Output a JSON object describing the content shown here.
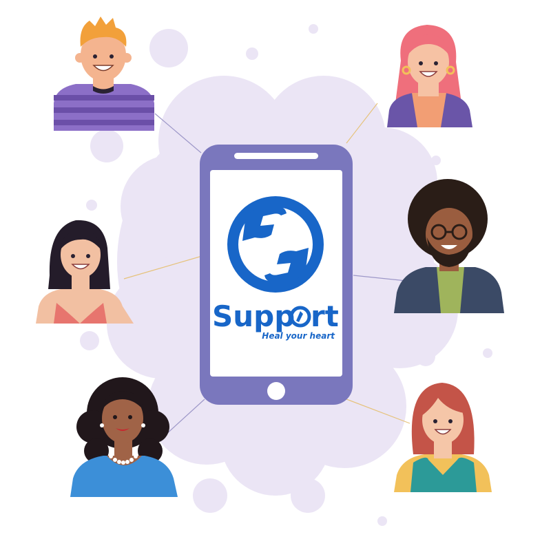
{
  "brand": {
    "name_left": "Supp",
    "name_right": "rt",
    "tagline": "Heal your heart"
  },
  "icons": [
    "support-hands-logo-icon",
    "phone-home-button-icon",
    "phone-speaker-icon"
  ],
  "colors": {
    "brand_blue": "#1866c8",
    "phone_purple": "#7a77bd",
    "cloud_lavender": "#ebe5f5",
    "connector_gold": "#e6c27a",
    "connector_purple": "#9d97c8"
  },
  "people": [
    {
      "id": "person-top-left",
      "shirt": "#8c6fc7",
      "stripe": "#6b4fa8",
      "hair": "#f2a03a",
      "skin": "#f4b48f"
    },
    {
      "id": "person-top-right",
      "shirt": "#f29e74",
      "jacket": "#6a55a8",
      "hair": "#ef6f7c",
      "skin": "#f6c2a4"
    },
    {
      "id": "person-middle-left",
      "shirt": "#e7756e",
      "hair": "#241c2a",
      "skin": "#f2c0a2"
    },
    {
      "id": "person-middle-right",
      "shirt": "#9fb45c",
      "jacket": "#3b4a66",
      "hair": "#2a1d17",
      "skin": "#9a5d3f"
    },
    {
      "id": "person-bottom-left",
      "shirt": "#3c8fd8",
      "hair": "#21171b",
      "skin": "#a06347"
    },
    {
      "id": "person-bottom-right",
      "shirt": "#2c9a98",
      "under": "#f2c15a",
      "hair": "#c45448",
      "skin": "#f5c6a8"
    }
  ]
}
